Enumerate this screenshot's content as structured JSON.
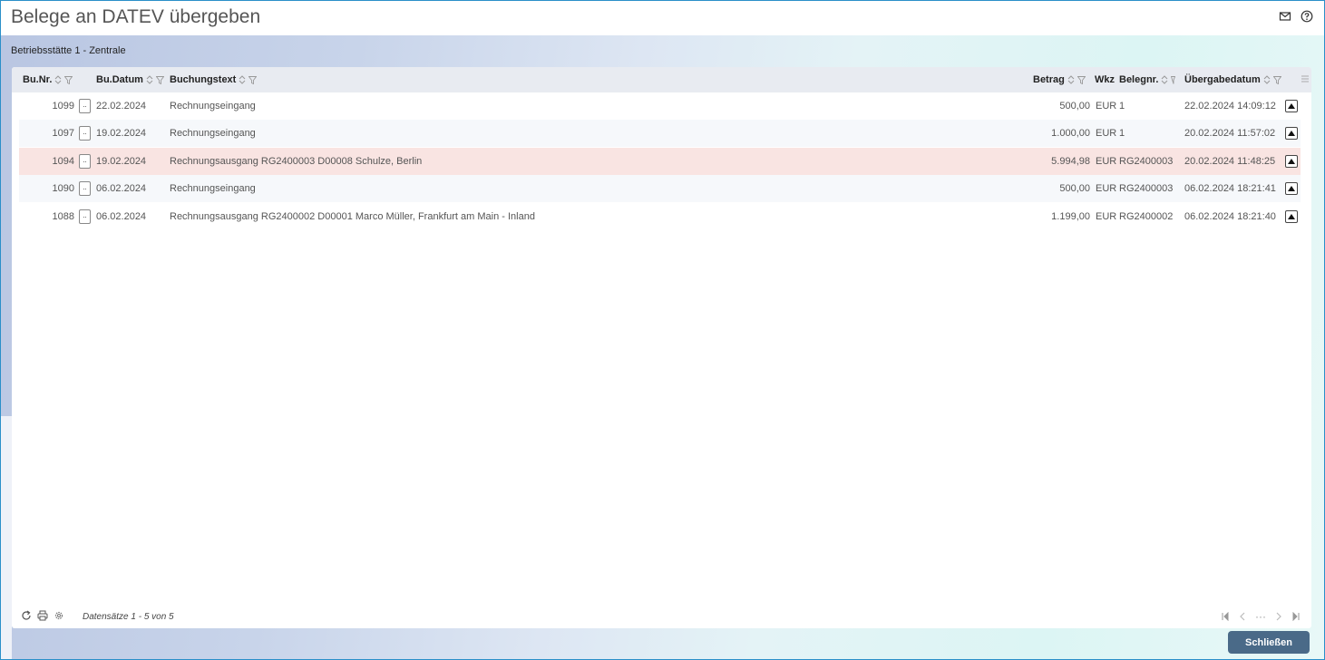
{
  "window": {
    "title": "Belege an DATEV übergeben"
  },
  "section": {
    "label": "Betriebsstätte 1 - Zentrale"
  },
  "columns": {
    "bunr": "Bu.Nr.",
    "budatum": "Bu.Datum",
    "buchungstext": "Buchungstext",
    "betrag": "Betrag",
    "wkz": "Wkz",
    "belegnr": "Belegnr.",
    "uebergabedatum": "Übergabedatum"
  },
  "rows": [
    {
      "bunr": "1099",
      "budatum": "22.02.2024",
      "buchungstext": "Rechnungseingang",
      "betrag": "500,00",
      "wkz": "EUR",
      "belegnr": "1",
      "uebergabedatum": "22.02.2024 14:09:12"
    },
    {
      "bunr": "1097",
      "budatum": "19.02.2024",
      "buchungstext": "Rechnungseingang",
      "betrag": "1.000,00",
      "wkz": "EUR",
      "belegnr": "1",
      "uebergabedatum": "20.02.2024 11:57:02"
    },
    {
      "bunr": "1094",
      "budatum": "19.02.2024",
      "buchungstext": "Rechnungsausgang RG2400003 D00008 Schulze, Berlin",
      "betrag": "5.994,98",
      "wkz": "EUR",
      "belegnr": "RG2400003",
      "uebergabedatum": "20.02.2024 11:48:25"
    },
    {
      "bunr": "1090",
      "budatum": "06.02.2024",
      "buchungstext": "Rechnungseingang",
      "betrag": "500,00",
      "wkz": "EUR",
      "belegnr": "RG2400003",
      "uebergabedatum": "06.02.2024 18:21:41"
    },
    {
      "bunr": "1088",
      "budatum": "06.02.2024",
      "buchungstext": "Rechnungsausgang RG2400002 D00001 Marco Müller, Frankfurt am Main - Inland",
      "betrag": "1.199,00",
      "wkz": "EUR",
      "belegnr": "RG2400002",
      "uebergabedatum": "06.02.2024 18:21:40"
    }
  ],
  "row_button_label": "..",
  "footer": {
    "record_count": "Datensätze 1 - 5 von 5"
  },
  "pager": {
    "ellipsis": "···"
  },
  "buttons": {
    "close": "Schließen"
  },
  "colors": {
    "selected_row": "#f9e4e2",
    "close_button": "#4a6a88",
    "window_border": "#2a8fc9"
  }
}
